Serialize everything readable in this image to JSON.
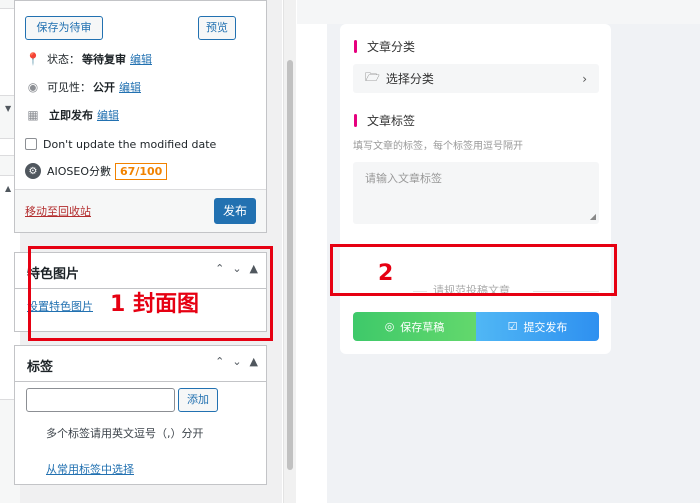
{
  "publish_box": {
    "save_pending_label": "保存为待审",
    "preview_label": "预览",
    "status_label": "状态：",
    "status_value": "等待复审",
    "status_edit": "编辑",
    "visibility_label": "可见性：",
    "visibility_value": "公开",
    "visibility_edit": "编辑",
    "publish_time_label": "立即发布",
    "publish_time_edit": "编辑",
    "dont_update_label": "Don't update the modified date",
    "aioseo_label": "AIOSEO分數",
    "aioseo_score": "67/100",
    "trash_link": "移动至回收站",
    "publish_button": "发布"
  },
  "featured_image_box": {
    "title": "特色图片",
    "set_link": "设置特色图片"
  },
  "tags_box": {
    "title": "标签",
    "add_button": "添加",
    "help_text": "多个标签请用英文逗号（,）分开",
    "choose_link": "从常用标签中选择"
  },
  "annotations": {
    "label_1": "1 封面图",
    "label_2": "2"
  },
  "right_panel": {
    "category_title": "文章分类",
    "category_select": "选择分类",
    "tag_title": "文章标签",
    "tag_hint": "填写文章的标签，每个标签用逗号隔开",
    "tag_placeholder": "请输入文章标签",
    "guideline_text": "请规范投稿文章",
    "save_draft_button": "保存草稿",
    "submit_button": "提交发布"
  },
  "colors": {
    "wp_blue": "#2271b1",
    "annotation_red": "#e60012",
    "section_bar": "#e6007e",
    "aioseo_orange": "#f18200"
  }
}
